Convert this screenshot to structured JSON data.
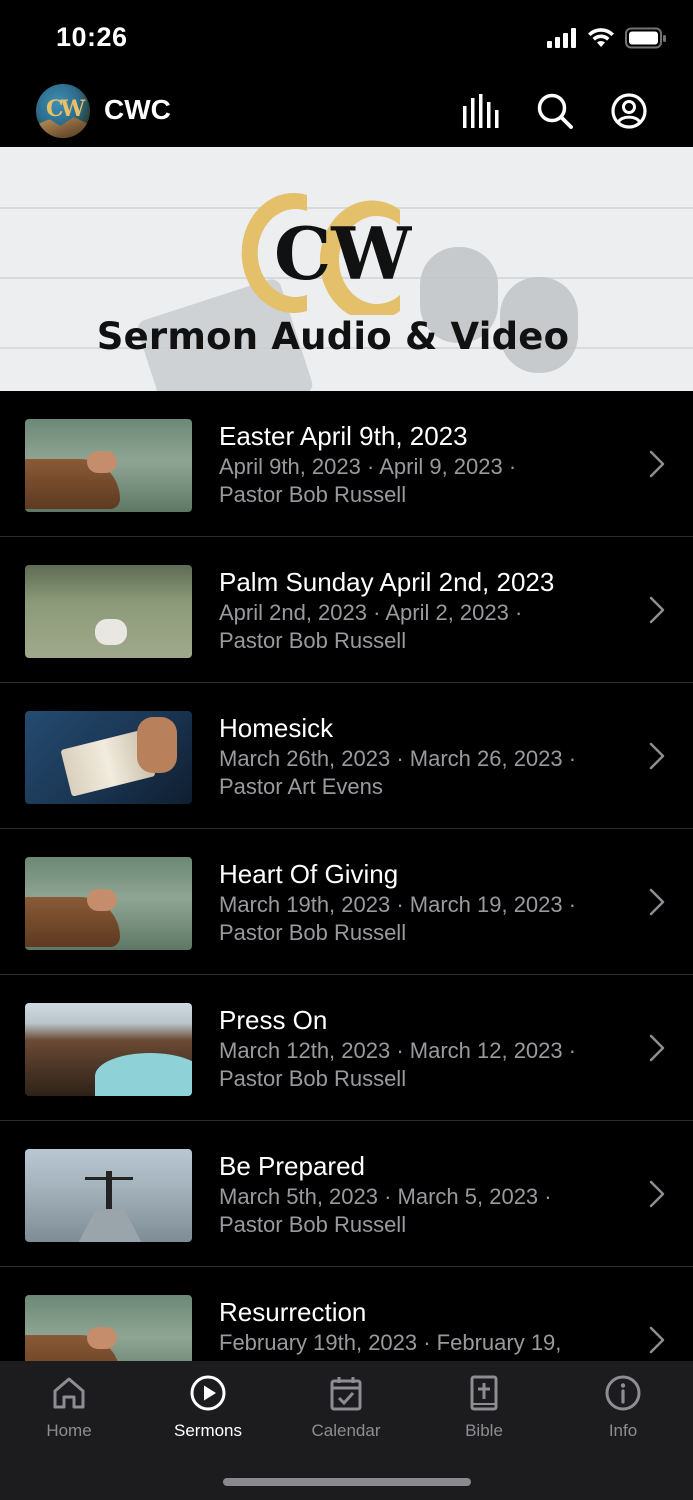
{
  "status_bar": {
    "time": "10:26"
  },
  "header": {
    "title": "CWC",
    "logo_text": "CW"
  },
  "hero": {
    "logo_text": "CW",
    "title": "Sermon Audio & Video"
  },
  "sermons": [
    {
      "title": "Easter April 9th, 2023",
      "meta_line1": "April 9th, 2023 · April 9, 2023 ·",
      "meta_line2": "Pastor Bob Russell",
      "thumb": "hands-praying"
    },
    {
      "title": "Palm Sunday April 2nd, 2023",
      "meta_line1": "April 2nd, 2023 · April 2, 2023 ·",
      "meta_line2": "Pastor Bob Russell",
      "thumb": "lamb-field"
    },
    {
      "title": "Homesick",
      "meta_line1": "March 26th, 2023 · March 26, 2023 ·",
      "meta_line2": "Pastor Art Evens",
      "thumb": "open-bible"
    },
    {
      "title": "Heart Of Giving",
      "meta_line1": "March 19th, 2023 · March 19, 2023 ·",
      "meta_line2": "Pastor Bob Russell",
      "thumb": "hands-praying"
    },
    {
      "title": "Press On",
      "meta_line1": "March 12th, 2023 · March 12, 2023 ·",
      "meta_line2": "Pastor Bob Russell",
      "thumb": "crater-lake"
    },
    {
      "title": "Be Prepared",
      "meta_line1": "March 5th, 2023 · March 5, 2023 ·",
      "meta_line2": "Pastor Bob Russell",
      "thumb": "mountain-person"
    },
    {
      "title": "Resurrection",
      "meta_line1": "February 19th, 2023 · February 19,",
      "meta_line2": "",
      "thumb": "hands-praying"
    }
  ],
  "tabs": [
    {
      "label": "Home",
      "icon": "home-icon",
      "active": false
    },
    {
      "label": "Sermons",
      "icon": "play-circle-icon",
      "active": true
    },
    {
      "label": "Calendar",
      "icon": "calendar-check-icon",
      "active": false
    },
    {
      "label": "Bible",
      "icon": "bible-icon",
      "active": false
    },
    {
      "label": "Info",
      "icon": "info-icon",
      "active": false
    }
  ],
  "colors": {
    "background": "#000000",
    "tab_bar": "#1c1c1e",
    "meta_text": "#9a9a9e",
    "logo_gold": "#e7c067"
  }
}
